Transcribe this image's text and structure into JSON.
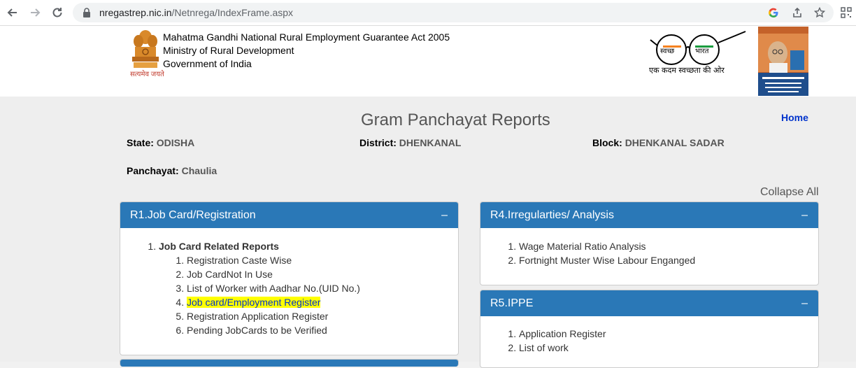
{
  "browser": {
    "url_host": "nregastrep.nic.in",
    "url_path": "/Netnrega/IndexFrame.aspx"
  },
  "header": {
    "org_line1": "Mahatma Gandhi National Rural Employment Guarantee Act 2005",
    "org_line2": "Ministry of Rural Development",
    "org_line3": "Government of India",
    "emblem_motto": "सत्यमेव जयते",
    "swachh_left": "स्वच्छ",
    "swachh_right": "भारत",
    "swachh_tagline": "एक कदम स्वच्छता की ओर"
  },
  "page": {
    "title": "Gram Panchayat Reports",
    "home_link": "Home",
    "collapse_all": "Collapse All"
  },
  "info": {
    "state_label": "State:",
    "state_value": "ODISHA",
    "district_label": "District:",
    "district_value": "DHENKANAL",
    "block_label": "Block:",
    "block_value": "DHENKANAL SADAR",
    "panchayat_label": "Panchayat:",
    "panchayat_value": "Chaulia"
  },
  "panels": {
    "r1": {
      "title": "R1.Job Card/Registration",
      "toggle": "–",
      "section": "Job Card Related Reports",
      "items": [
        "Registration Caste Wise",
        "Job CardNot In Use",
        "List of Worker with Aadhar No.(UID No.)",
        "Job card/Employment Register",
        "Registration Application Register",
        "Pending JobCards to be Verified"
      ]
    },
    "r4": {
      "title": "R4.Irregularties/ Analysis",
      "toggle": "–",
      "items": [
        "Wage Material Ratio Analysis",
        "Fortnight Muster Wise Labour Enganged"
      ]
    },
    "r5": {
      "title": "R5.IPPE",
      "toggle": "–",
      "items": [
        "Application Register",
        "List of work"
      ]
    }
  },
  "colors": {
    "panel_header": "#2a78b7",
    "highlight": "#ffff00",
    "link": "#0033cc"
  }
}
